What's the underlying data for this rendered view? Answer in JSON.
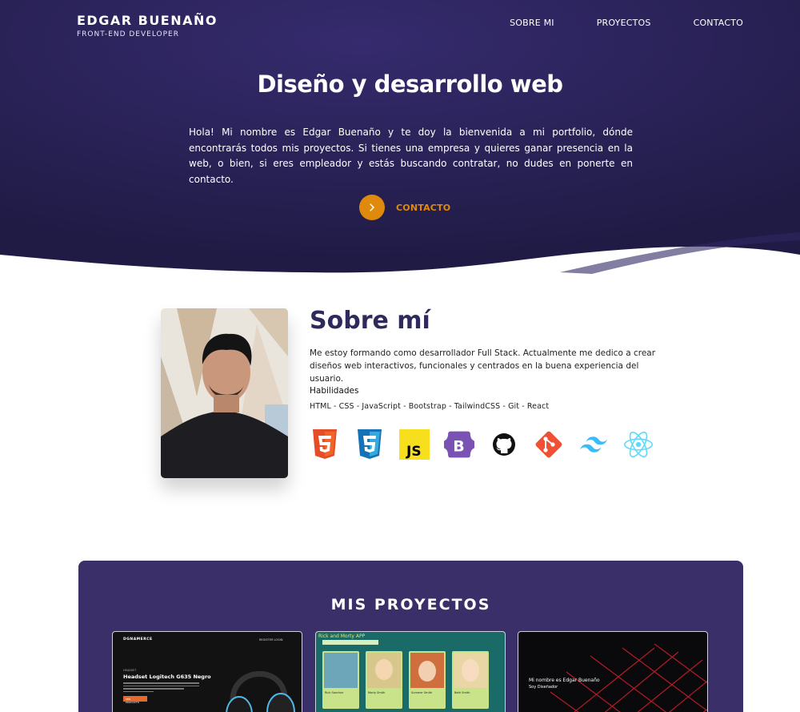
{
  "header": {
    "brand_name": "EDGAR BUENAÑO",
    "brand_role": "FRONT-END DEVELOPER",
    "nav": [
      "SOBRE MI",
      "PROYECTOS",
      "CONTACTO"
    ]
  },
  "hero": {
    "title": "Diseño y desarrollo web",
    "text": "Hola! Mi nombre es Edgar Buenaño y te doy la bienvenida a mi portfolio, dónde encontrarás todos mis proyectos. Si tienes una empresa y quieres ganar presencia en la web, o bien, si eres empleador y estás buscando contratar, no dudes en ponerte en contacto.",
    "cta_label": "CONTACTO"
  },
  "about": {
    "title": "Sobre mí",
    "text": "Me estoy formando como desarrollador Full Stack. Actualmente me dedico a crear diseños web interactivos, funcionales y centrados en la buena experiencia del usuario.",
    "skills_title": "Habilidades",
    "skills_list": "HTML - CSS - JavaScript - Bootstrap - TailwindCSS - Git - React",
    "skill_icons": [
      "html5-icon",
      "css3-icon",
      "javascript-icon",
      "bootstrap-icon",
      "github-icon",
      "git-icon",
      "tailwindcss-icon",
      "react-icon"
    ]
  },
  "projects": {
    "title": "MIS PROYECTOS",
    "cards": [
      {
        "brand": "DGNAMERCE",
        "nav": "REGISTER LOGIN",
        "tag": "HEADSET",
        "product": "Headset Logitech G635 Negro",
        "button": "VER PRODUCTO"
      },
      {
        "app_title": "Rick and Morty APP",
        "characters": [
          "Rick Sanchez",
          "Morty Smith",
          "Summer Smith",
          "Beth Smith"
        ]
      },
      {
        "line1": "Mi nombre es Edgar Buenaño",
        "line2": "Soy Diseñador"
      }
    ]
  },
  "colors": {
    "hero_bg": "#27214f",
    "accent": "#e08a0b",
    "projects_bg": "#3a2f68",
    "about_title": "#2e2a5c"
  }
}
